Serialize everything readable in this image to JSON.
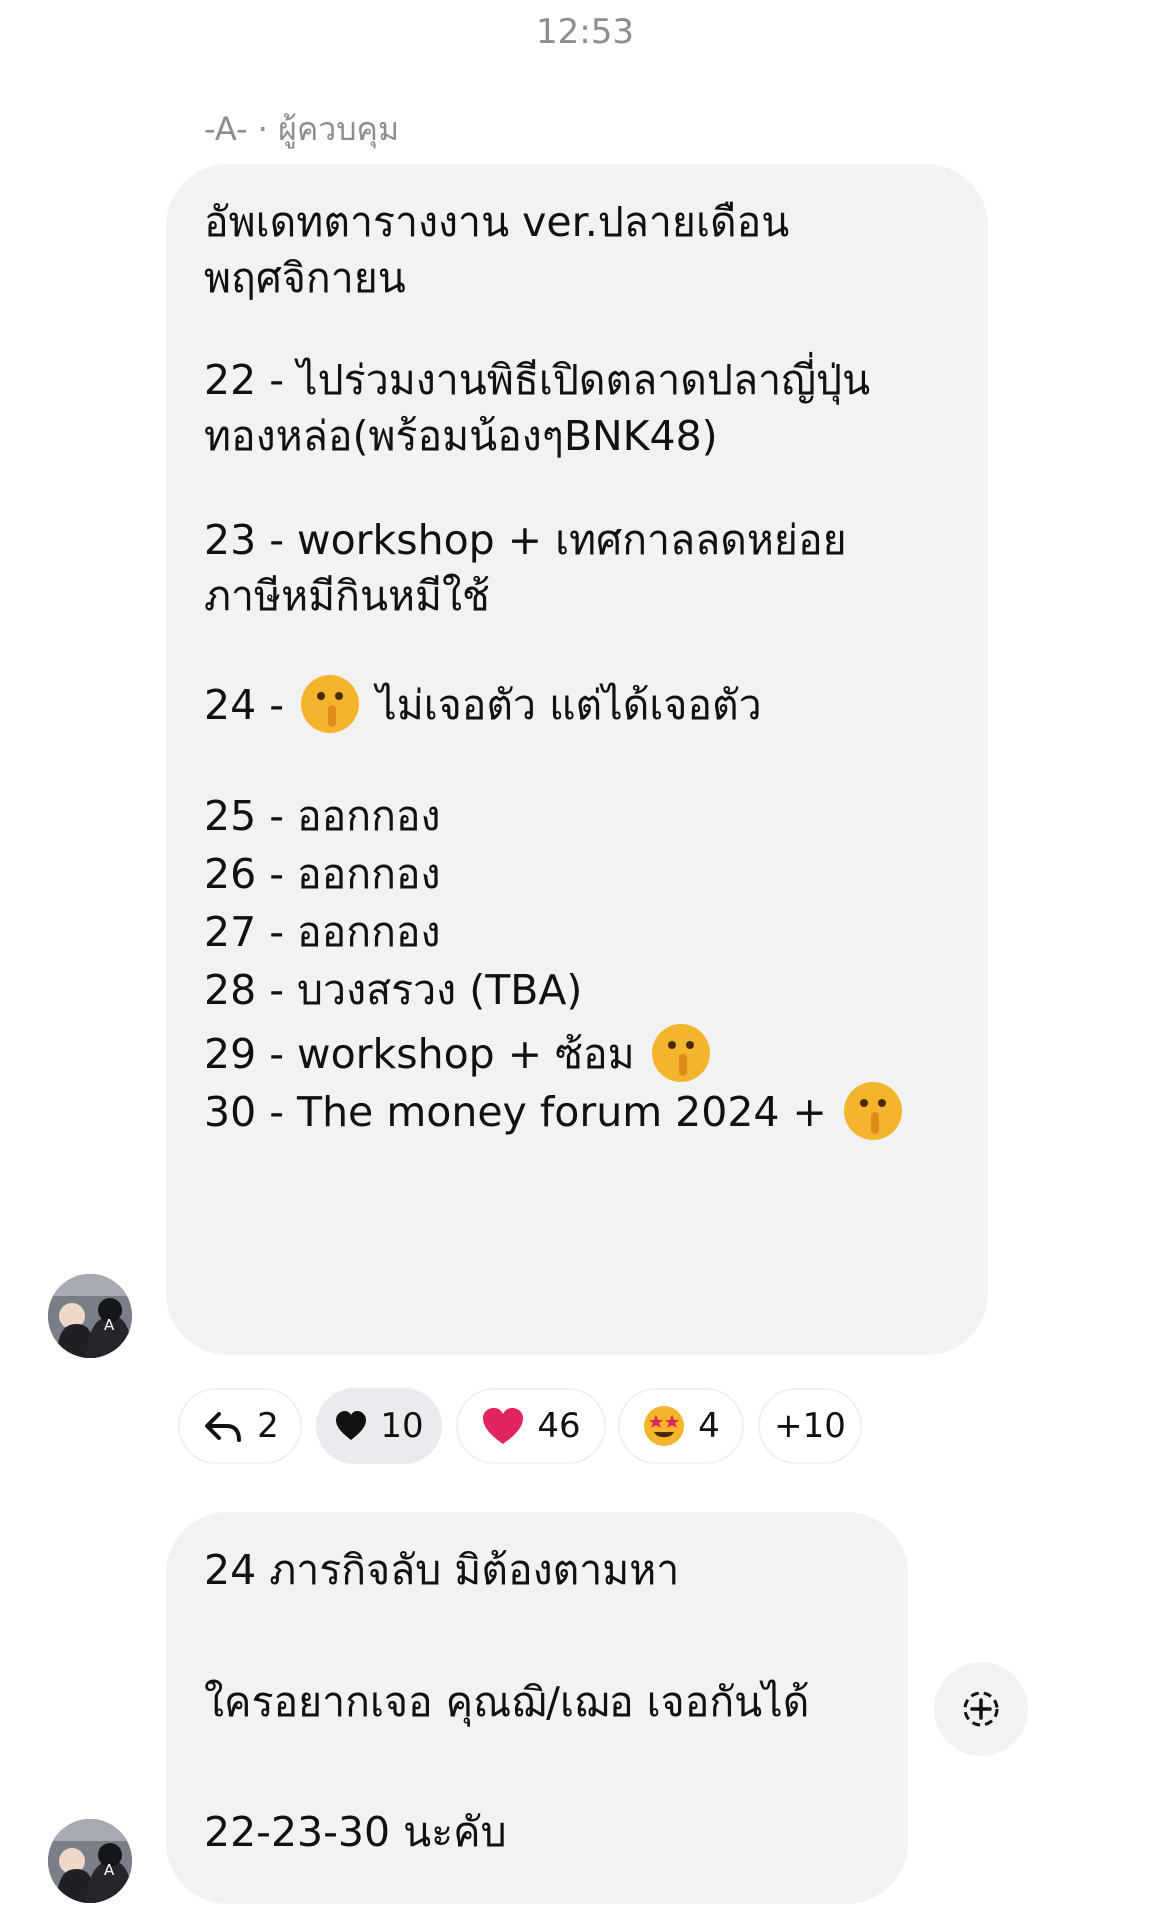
{
  "timestamp": "12:53",
  "sender": {
    "name_line": "-A- · ผู้ควบคุม"
  },
  "messages": [
    {
      "lines": [
        "อัพเดทตารางงาน ver.ปลายเดือน",
        "พฤศจิกายน",
        "22 - ไปร่วมงานพิธีเปิดตลาดปลาญี่ปุ่น",
        "ทองหล่อ(พร้อมน้องๆBNK48)",
        "23 - workshop  + เทศกาลลดหย่อย",
        "ภาษีหมีกินหมีใช้",
        "24 -",
        "ไม่เจอตัว แต่ได้เจอตัว",
        "25 - ออกกอง",
        "26 - ออกกอง",
        "27 - ออกกอง",
        "28 - บวงสรวง (TBA)",
        "29 - workshop + ซ้อม",
        "30 - The money forum 2024 +"
      ],
      "emoji": "shushing-face"
    },
    {
      "lines": [
        "24 ภารกิจลับ มิต้องตามหา",
        "ใครอยากเจอ คุณฌิ/เฌอ เจอกันได้",
        "22-23-30 นะคับ"
      ]
    }
  ],
  "reactions": [
    {
      "icon": "reply-icon",
      "count": "2"
    },
    {
      "icon": "black-heart-icon",
      "count": "10"
    },
    {
      "icon": "red-heart-icon",
      "count": "46"
    },
    {
      "icon": "star-struck-icon",
      "count": "4"
    },
    {
      "label": "+10"
    }
  ],
  "add_reaction_icon": "add-reaction-icon",
  "colors": {
    "bubble": "#f1f2f4",
    "muted_text": "#8a8d91",
    "heart_red": "#e0245e",
    "emoji_yellow": "#f4b42c"
  }
}
